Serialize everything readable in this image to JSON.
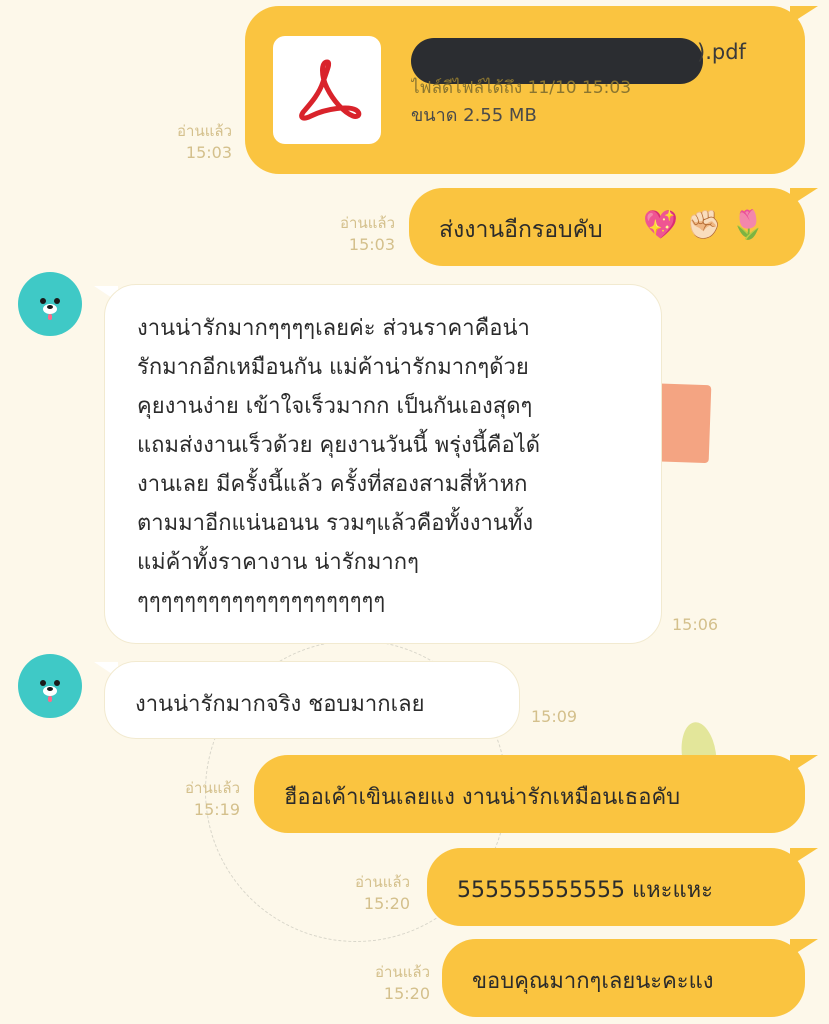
{
  "messages": [
    {
      "id": "file",
      "direction": "out",
      "type": "file",
      "file": {
        "name_suffix": ").pdf",
        "subtitle": "ไฟล์ดีไฟล์ได้ถึง 11/10 15:03",
        "size_label": "ขนาด 2.55 MB",
        "icon": "pdf-acrobat-icon",
        "name_redacted": true
      },
      "read_label": "อ่านแล้ว",
      "time": "15:03"
    },
    {
      "id": "m2",
      "direction": "out",
      "text": "ส่งงานอีกรอบคับ",
      "emojis": [
        "💖",
        "✊🏻",
        "🌷"
      ],
      "read_label": "อ่านแล้ว",
      "time": "15:03"
    },
    {
      "id": "m3",
      "direction": "in",
      "lines": [
        "งานน่ารักมากๆๆๆๆเลยค่ะ ส่วนราคาคือน่า",
        "รักมากอีกเหมือนกัน แม่ค้าน่ารักมากๆด้วย",
        "คุยงานง่าย เข้าใจเร็วมากก เป็นกันเองสุดๆ",
        "แถมส่งงานเร็วด้วย คุยงานวันนี้ พรุ่งนี้คือได้",
        "งานเลย มีครั้งนี้แล้ว ครั้งที่สองสามสี่ห้าหก",
        "ตามมาอีกแน่นอนน รวมๆแล้วคือทั้งงานทั้ง",
        "แม่ค้าทั้งราคางาน น่ารักมากๆ",
        "ๆๆๆๆๆๆๆๆๆๆๆๆๆๆๆๆๆๆๆๆๆ"
      ],
      "time": "15:06"
    },
    {
      "id": "m4",
      "direction": "in",
      "text": "งานน่ารักมากจริง ชอบมากเลย",
      "time": "15:09"
    },
    {
      "id": "m5",
      "direction": "out",
      "text": "ฮืออเค้าเขินเลยแง งานน่ารักเหมือนเธอคับ",
      "read_label": "อ่านแล้ว",
      "time": "15:19"
    },
    {
      "id": "m6",
      "direction": "out",
      "text": "555555555555 แหะแหะ",
      "read_label": "อ่านแล้ว",
      "time": "15:20"
    },
    {
      "id": "m7",
      "direction": "out",
      "text": "ขอบคุณมากๆเลยนะคะแง",
      "read_label": "อ่านแล้ว",
      "time": "15:20"
    }
  ],
  "colors": {
    "background": "#fdf8ea",
    "outgoing_bubble": "#fac440",
    "incoming_bubble": "#ffffff",
    "avatar": "#3fc9c6",
    "meta_text": "#d4c08c",
    "redaction": "#2b2d31",
    "pdf_red": "#d9232b"
  },
  "avatar_icon": "bear-avatar-icon"
}
